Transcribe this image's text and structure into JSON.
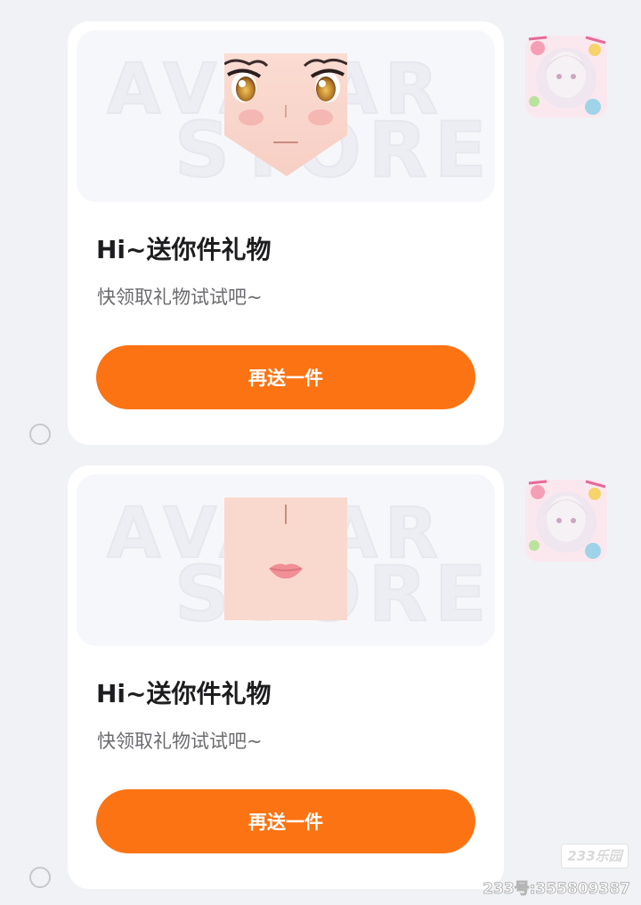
{
  "messages": [
    {
      "card": {
        "watermark_line1": "AVATAR",
        "watermark_line2": "STORE",
        "preview_icon": "anime-face-icon",
        "title": "Hi~送你件礼物",
        "subtitle": "快领取礼物试试吧~",
        "button_label": "再送一件"
      },
      "sender_avatar_icon": "anime-girl-avatar-icon"
    },
    {
      "card": {
        "watermark_line1": "AVATAR",
        "watermark_line2": "STORE",
        "preview_icon": "face-nose-mouth-icon",
        "title": "Hi~送你件礼物",
        "subtitle": "快领取礼物试试吧~",
        "button_label": "再送一件"
      },
      "sender_avatar_icon": "anime-girl-avatar-icon"
    }
  ],
  "colors": {
    "background": "#f1f2f6",
    "card": "#ffffff",
    "accent": "#fb7312"
  },
  "watermark": {
    "logo": "233乐园",
    "id_text": "233号:355809387"
  }
}
